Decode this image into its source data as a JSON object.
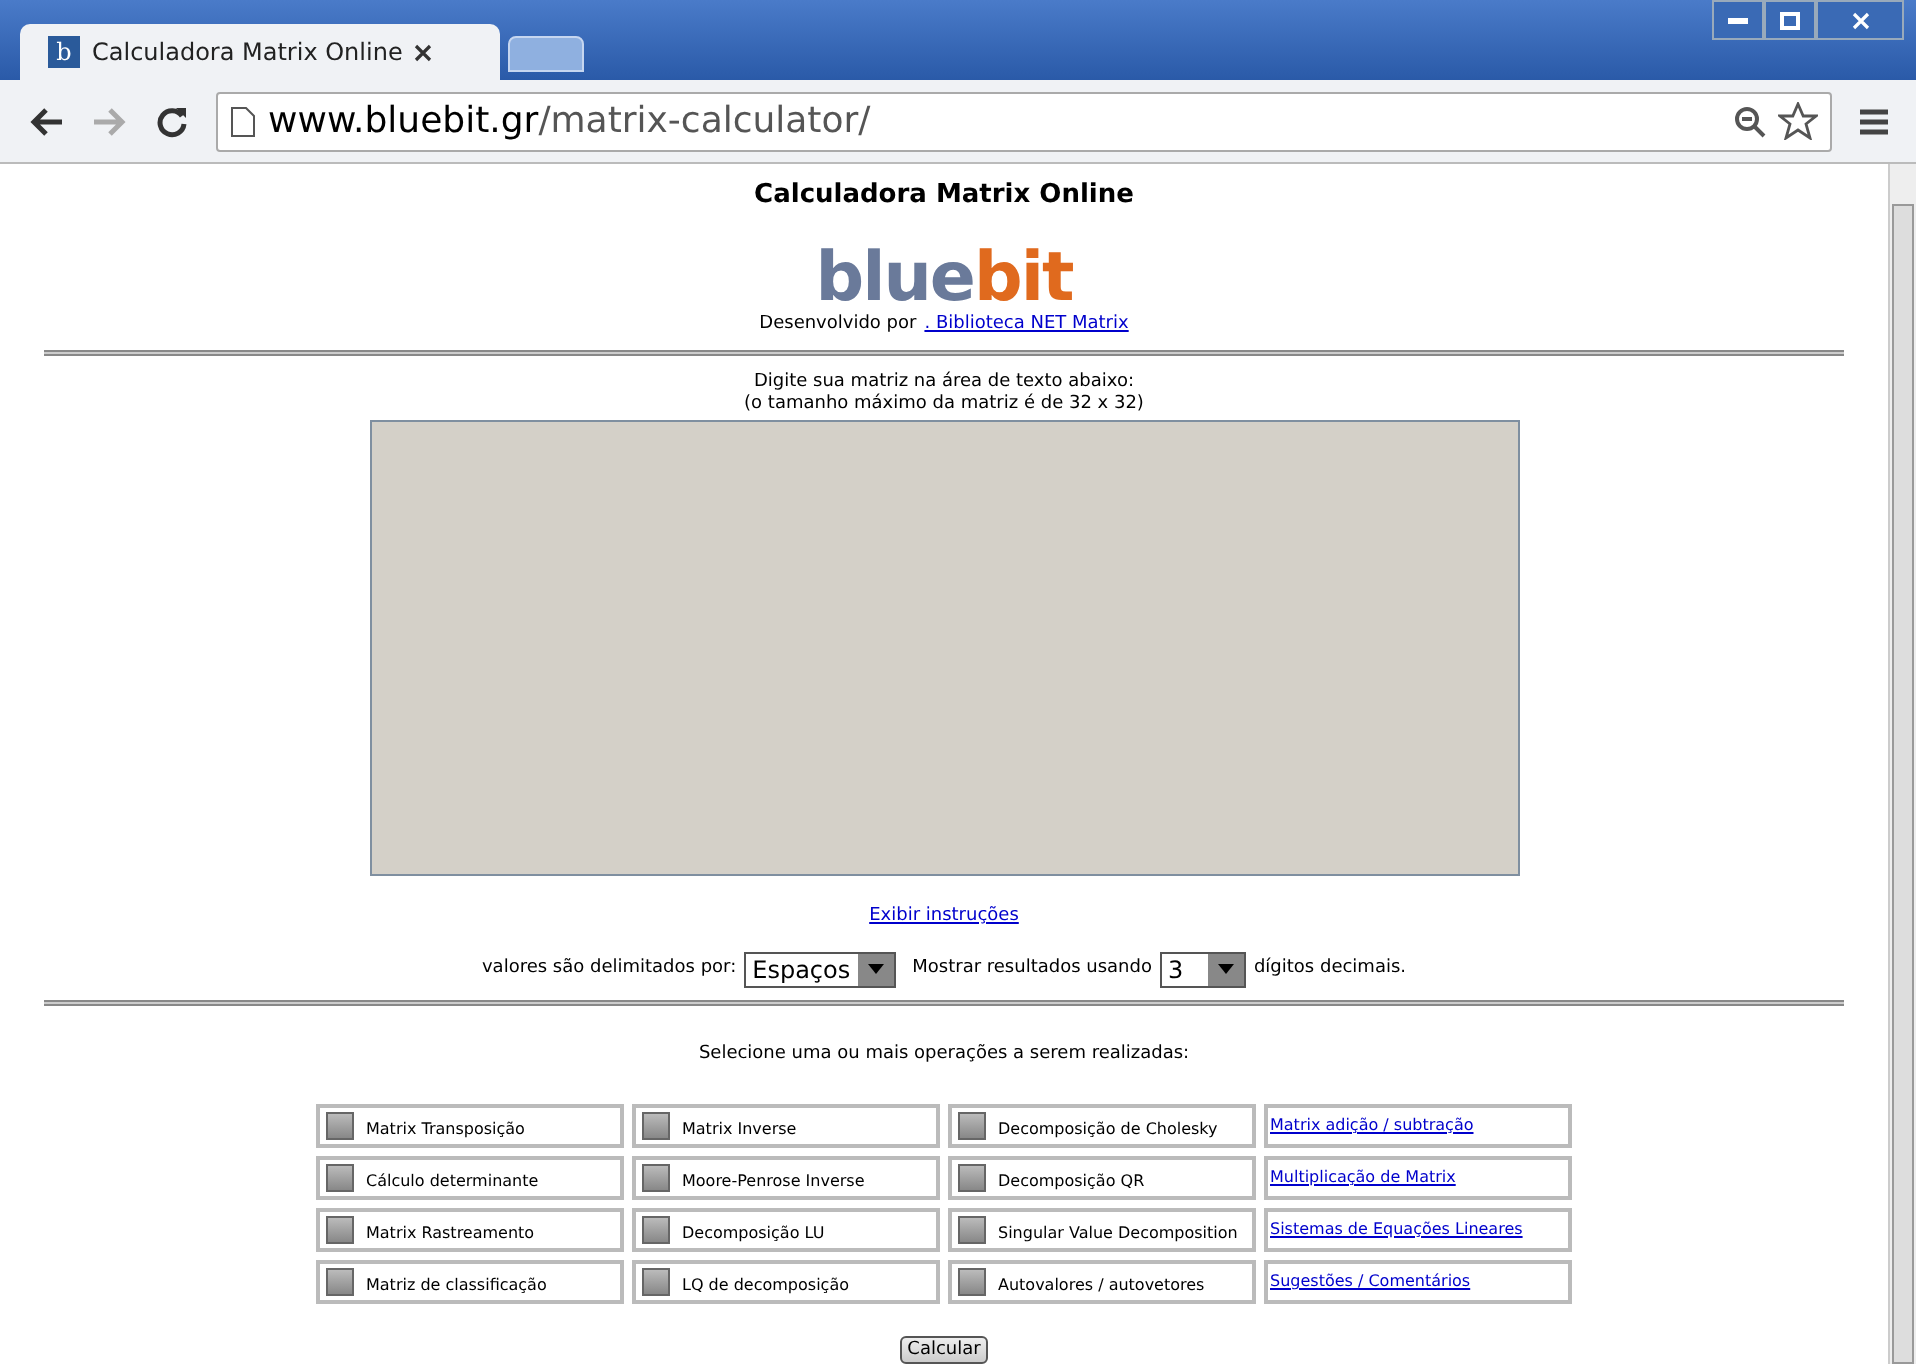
{
  "browser": {
    "favicon_letter": "b",
    "tab_title": "Calculadora Matrix Online",
    "url_host": "www.bluebit.gr",
    "url_path": "/matrix-calculator/"
  },
  "page": {
    "title": "Calculadora Matrix Online",
    "logo": {
      "part_1": "blue",
      "part_2": "bit"
    },
    "developed_by": "Desenvolvido por",
    "library_link": ". Biblioteca NET Matrix",
    "instructions": [
      "Digite sua matriz na área de texto abaixo:",
      "(o tamanho máximo da matriz é de 32 x 32)"
    ],
    "show_instructions_link": "Exibir instruções",
    "delimiter_label": "valores são delimitados por:",
    "delimiter_value": "Espaços",
    "results_label": "Mostrar resultados usando",
    "digits_value": "3",
    "digits_suffix": "dígitos decimais.",
    "operations_prompt": "Selecione uma ou mais operações a serem realizadas:",
    "operations": [
      {
        "kind": "checkbox",
        "label": "Matrix Transposição",
        "checked": false
      },
      {
        "kind": "checkbox",
        "label": "Matrix Inverse",
        "checked": false
      },
      {
        "kind": "checkbox",
        "label": "Decomposição de Cholesky",
        "checked": false
      },
      {
        "kind": "link",
        "label": "Matrix adição / subtração"
      },
      {
        "kind": "checkbox",
        "label": "Cálculo determinante",
        "checked": false
      },
      {
        "kind": "checkbox",
        "label": "Moore-Penrose Inverse",
        "checked": false
      },
      {
        "kind": "checkbox",
        "label": "Decomposição QR",
        "checked": false
      },
      {
        "kind": "link",
        "label": "Multiplicação de Matrix"
      },
      {
        "kind": "checkbox",
        "label": "Matrix Rastreamento",
        "checked": false
      },
      {
        "kind": "checkbox",
        "label": "Decomposição LU",
        "checked": false
      },
      {
        "kind": "checkbox",
        "label": "Singular Value Decomposition",
        "checked": false
      },
      {
        "kind": "link",
        "label": "Sistemas de Equações Lineares"
      },
      {
        "kind": "checkbox",
        "label": "Matriz de classificação",
        "checked": false
      },
      {
        "kind": "checkbox",
        "label": "LQ de decomposição",
        "checked": false
      },
      {
        "kind": "checkbox",
        "label": "Autovalores / autovetores",
        "checked": false
      },
      {
        "kind": "link",
        "label": "Sugestões / Comentários"
      }
    ],
    "submit": "Calcular"
  }
}
